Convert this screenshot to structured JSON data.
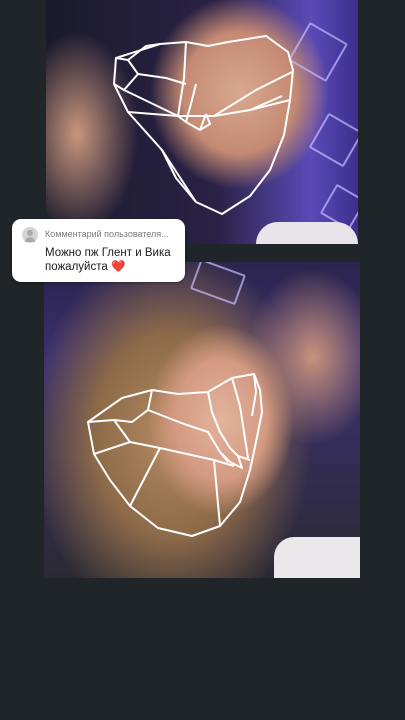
{
  "comment": {
    "header": "Комментарий пользователя...",
    "text": "Можно пж Глент и Вика пожалуйста",
    "emoji": "❤️"
  },
  "icons": {
    "avatar": "default-user-avatar-icon"
  },
  "colors": {
    "background": "#1f2528",
    "comment_card": "#ffffff",
    "mesh_lines": "#ffffff",
    "heart": "#d8262e"
  }
}
